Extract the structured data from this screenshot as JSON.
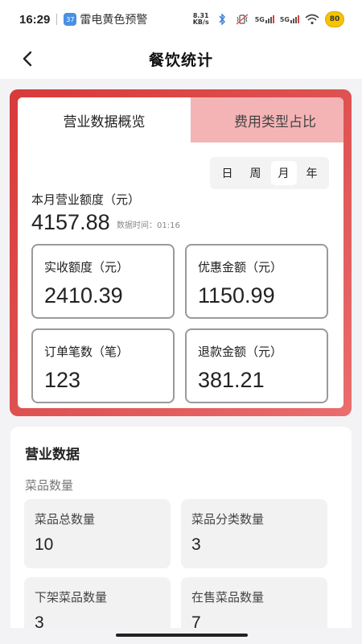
{
  "status_bar": {
    "time": "16:29",
    "alert_badge": "37",
    "alert_text": "雷电黄色预警",
    "net_speed_value": "8.31",
    "net_speed_unit": "KB/s",
    "signal1": "5G",
    "signal2": "5G",
    "battery": "80",
    "icons": [
      "bluetooth-icon",
      "vibrate-icon",
      "signal-icon",
      "signal-icon",
      "wifi-icon",
      "battery-icon"
    ]
  },
  "nav": {
    "title": "餐饮统计"
  },
  "overview": {
    "tabs": [
      {
        "label": "营业数据概览",
        "active": true
      },
      {
        "label": "费用类型占比",
        "active": false
      }
    ],
    "periods": [
      {
        "label": "日",
        "selected": false
      },
      {
        "label": "周",
        "selected": false
      },
      {
        "label": "月",
        "selected": true
      },
      {
        "label": "年",
        "selected": false
      }
    ],
    "month_label": "本月营业额度（元）",
    "month_value": "4157.88",
    "data_time": "数据时间：01:16",
    "stats": [
      {
        "label": "实收额度（元）",
        "value": "2410.39"
      },
      {
        "label": "优惠金额（元）",
        "value": "1150.99"
      },
      {
        "label": "订单笔数（笔）",
        "value": "123"
      },
      {
        "label": "退款金额（元）",
        "value": "381.21"
      }
    ]
  },
  "business": {
    "heading": "营业数据",
    "subheading": "菜品数量",
    "tiles": [
      {
        "label": "菜品总数量",
        "value": "10"
      },
      {
        "label": "菜品分类数量",
        "value": "3"
      },
      {
        "label": "下架菜品数量",
        "value": "3"
      },
      {
        "label": "在售菜品数量",
        "value": "7"
      }
    ]
  },
  "colors": {
    "accent_red": "#d83a3a",
    "tab_pink": "#f4b4b6",
    "battery_yellow": "#f4c400"
  }
}
